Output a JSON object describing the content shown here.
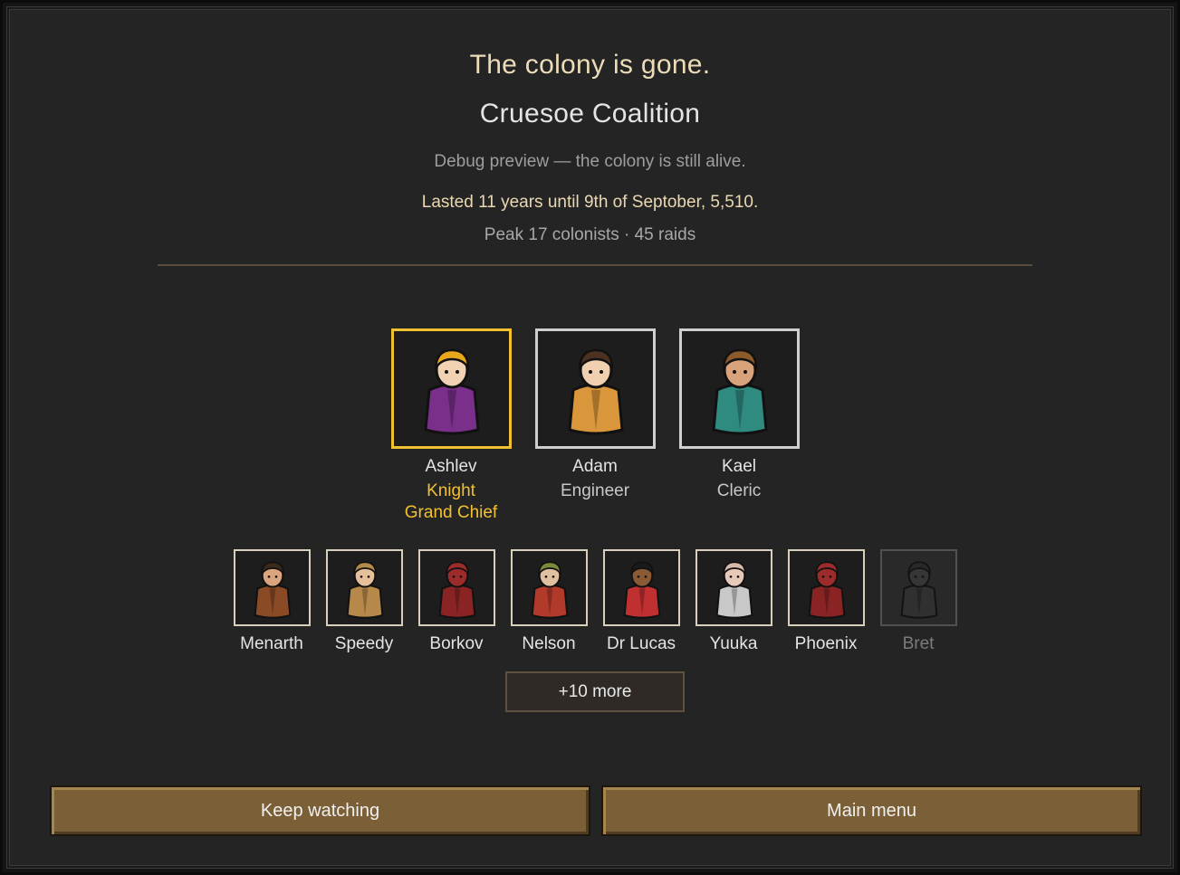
{
  "header": {
    "title": "The colony is gone.",
    "faction": "Cruesoe Coalition",
    "debug_note": "Debug preview — the colony is still alive.",
    "lasted": "Lasted 11 years until 9th of Septober, 5,510.",
    "peak": "Peak 17 colonists · 45 raids"
  },
  "featured": [
    {
      "name": "Ashlev",
      "role1": "Knight",
      "role2": "Grand Chief",
      "leader": true,
      "hair": "#e7a81c",
      "skin": "#f1d3b4",
      "outfit": "#7a2f8a",
      "icon": "colonist-portrait-icon"
    },
    {
      "name": "Adam",
      "role1": "Engineer",
      "role2": "",
      "leader": false,
      "hair": "#4b3120",
      "skin": "#f0d0b0",
      "outfit": "#d9963a",
      "icon": "colonist-portrait-icon"
    },
    {
      "name": "Kael",
      "role1": "Cleric",
      "role2": "",
      "leader": false,
      "hair": "#8a5a2b",
      "skin": "#d8a27a",
      "outfit": "#2f8a80",
      "icon": "colonist-portrait-icon"
    }
  ],
  "colonists": [
    {
      "name": "Menarth",
      "dead": false,
      "hair": "#3a2a1a",
      "skin": "#d9a47e",
      "outfit": "#8a4a26"
    },
    {
      "name": "Speedy",
      "dead": false,
      "hair": "#b48a4a",
      "skin": "#e6c09a",
      "outfit": "#b6884a"
    },
    {
      "name": "Borkov",
      "dead": false,
      "hair": "#9c2b2b",
      "skin": "#9c2b2b",
      "outfit": "#8a2424"
    },
    {
      "name": "Nelson",
      "dead": false,
      "hair": "#7a8a3a",
      "skin": "#e0c0a0",
      "outfit": "#b23a2a"
    },
    {
      "name": "Dr Lucas",
      "dead": false,
      "hair": "#1a1a1a",
      "skin": "#8a5a34",
      "outfit": "#c03030"
    },
    {
      "name": "Yuuka",
      "dead": false,
      "hair": "#d8b8a8",
      "skin": "#e8c8b8",
      "outfit": "#c8c8c8"
    },
    {
      "name": "Phoenix",
      "dead": false,
      "hair": "#9c2b2b",
      "skin": "#9c2b2b",
      "outfit": "#8a2424"
    },
    {
      "name": "Bret",
      "dead": true,
      "hair": "#2a2a2a",
      "skin": "#3a3a3a",
      "outfit": "#333333"
    }
  ],
  "more_label": "+10 more",
  "buttons": {
    "keep_watching": "Keep watching",
    "main_menu": "Main menu"
  },
  "colors": {
    "leader_border": "#f2c132",
    "button": "#7b5f37"
  }
}
